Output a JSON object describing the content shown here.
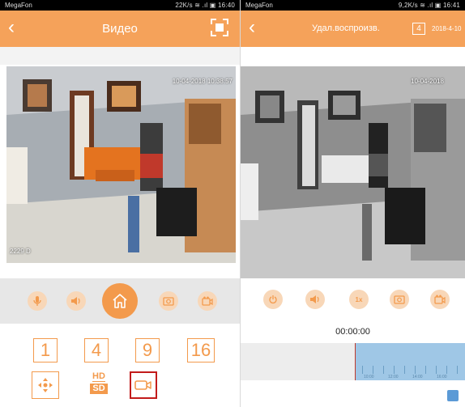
{
  "left": {
    "status": {
      "carrier": "MegaFon",
      "right": "22K/s ≋ .ıl ▣ 16:40"
    },
    "title": "Видео",
    "video": {
      "timestamp": "10-04-2018 10:38:57",
      "osd": "2229 D"
    },
    "grid_buttons": [
      "1",
      "4",
      "9",
      "16"
    ],
    "hd_label": "HD",
    "sd_label": "SD"
  },
  "right": {
    "status": {
      "carrier": "MegaFon",
      "right": "9,2K/s ≋ .ıl ▣ 16:41"
    },
    "title": "Удал.воспроизв.",
    "screen_count": "4",
    "date": "2018-4-10",
    "video": {
      "timestamp": "10-04-2018"
    },
    "speed_label": "1x",
    "timecode": "00:00:00",
    "timeline": {
      "tick_labels": [
        "10:00",
        "12:00",
        "14:00",
        "16:00"
      ],
      "played_fraction": 0.51
    }
  },
  "colors": {
    "accent": "#f39a4c",
    "topbar": "#f5a25a",
    "selected_border": "#c21b1b"
  }
}
